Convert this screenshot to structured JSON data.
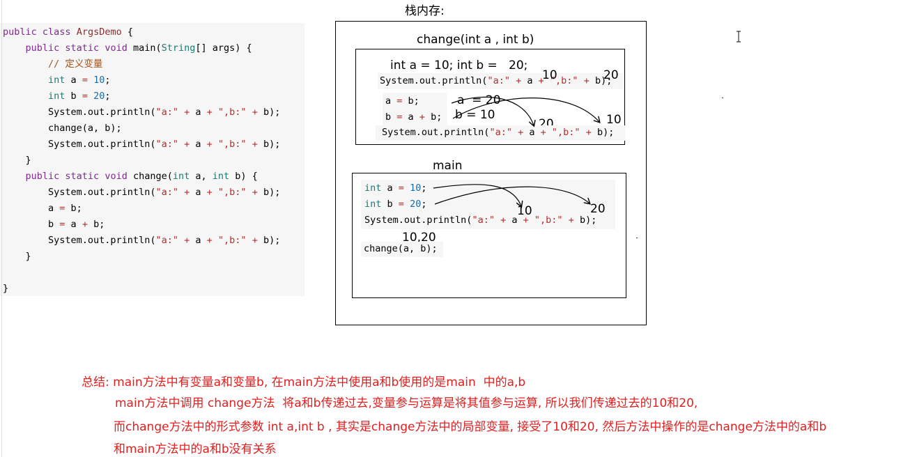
{
  "stack_title": "栈内存:",
  "code": {
    "lines": [
      [
        [
          "kw",
          "public "
        ],
        [
          "kw",
          "class "
        ],
        [
          "cls",
          "ArgsDemo"
        ],
        [
          "p",
          " {"
        ]
      ],
      [
        [
          "p",
          "    "
        ],
        [
          "kw",
          "public "
        ],
        [
          "kw",
          "static "
        ],
        [
          "kw",
          "void "
        ],
        [
          "p",
          "main("
        ],
        [
          "ty",
          "String"
        ],
        [
          "p",
          "[] args) {"
        ]
      ],
      [
        [
          "p",
          "        "
        ],
        [
          "cm",
          "// 定义变量"
        ]
      ],
      [
        [
          "p",
          "        "
        ],
        [
          "ty",
          "int"
        ],
        [
          "p",
          " a "
        ],
        [
          "op",
          "="
        ],
        [
          "p",
          " "
        ],
        [
          "num",
          "10"
        ],
        [
          "p",
          ";"
        ]
      ],
      [
        [
          "p",
          "        "
        ],
        [
          "ty",
          "int"
        ],
        [
          "p",
          " b "
        ],
        [
          "op",
          "="
        ],
        [
          "p",
          " "
        ],
        [
          "num",
          "20"
        ],
        [
          "p",
          ";"
        ]
      ],
      [
        [
          "p",
          "        System.out.println("
        ],
        [
          "str",
          "\"a:\""
        ],
        [
          "p",
          " "
        ],
        [
          "op",
          "+"
        ],
        [
          "p",
          " a "
        ],
        [
          "op",
          "+"
        ],
        [
          "p",
          " "
        ],
        [
          "str",
          "\",b:\""
        ],
        [
          "p",
          " "
        ],
        [
          "op",
          "+"
        ],
        [
          "p",
          " b);"
        ]
      ],
      [
        [
          "p",
          "        change(a, b);"
        ]
      ],
      [
        [
          "p",
          "        System.out.println("
        ],
        [
          "str",
          "\"a:\""
        ],
        [
          "p",
          " "
        ],
        [
          "op",
          "+"
        ],
        [
          "p",
          " a "
        ],
        [
          "op",
          "+"
        ],
        [
          "p",
          " "
        ],
        [
          "str",
          "\",b:\""
        ],
        [
          "p",
          " "
        ],
        [
          "op",
          "+"
        ],
        [
          "p",
          " b);"
        ]
      ],
      [
        [
          "p",
          "    }"
        ]
      ],
      [
        [
          "p",
          "    "
        ],
        [
          "kw",
          "public "
        ],
        [
          "kw",
          "static "
        ],
        [
          "kw",
          "void "
        ],
        [
          "p",
          "change("
        ],
        [
          "ty",
          "int"
        ],
        [
          "p",
          " a, "
        ],
        [
          "ty",
          "int"
        ],
        [
          "p",
          " b) {"
        ]
      ],
      [
        [
          "p",
          "        System.out.println("
        ],
        [
          "str",
          "\"a:\""
        ],
        [
          "p",
          " "
        ],
        [
          "op",
          "+"
        ],
        [
          "p",
          " a "
        ],
        [
          "op",
          "+"
        ],
        [
          "p",
          " "
        ],
        [
          "str",
          "\",b:\""
        ],
        [
          "p",
          " "
        ],
        [
          "op",
          "+"
        ],
        [
          "p",
          " b);"
        ]
      ],
      [
        [
          "p",
          "        a "
        ],
        [
          "op",
          "="
        ],
        [
          "p",
          " b;"
        ]
      ],
      [
        [
          "p",
          "        b "
        ],
        [
          "op",
          "="
        ],
        [
          "p",
          " a "
        ],
        [
          "op",
          "+"
        ],
        [
          "p",
          " b;"
        ]
      ],
      [
        [
          "p",
          "        System.out.println("
        ],
        [
          "str",
          "\"a:\""
        ],
        [
          "p",
          " "
        ],
        [
          "op",
          "+"
        ],
        [
          "p",
          " a "
        ],
        [
          "op",
          "+"
        ],
        [
          "p",
          " "
        ],
        [
          "str",
          "\",b:\""
        ],
        [
          "p",
          " "
        ],
        [
          "op",
          "+"
        ],
        [
          "p",
          " b);"
        ]
      ],
      [
        [
          "p",
          "    }"
        ]
      ],
      [
        [
          "p",
          ""
        ]
      ],
      [
        [
          "p",
          "}"
        ]
      ]
    ]
  },
  "change_frame": {
    "title": "change(int a , int b)",
    "params_line": "int a = 10; int b =   20;",
    "println1": [
      [
        "p",
        "System.out.println("
      ],
      [
        "str",
        "\"a:\""
      ],
      [
        "p",
        " "
      ],
      [
        "op",
        "+"
      ],
      [
        "p",
        " a "
      ],
      [
        "op",
        "+"
      ],
      [
        "p",
        " "
      ],
      [
        "str",
        "\",b:\""
      ],
      [
        "p",
        " "
      ],
      [
        "op",
        "+"
      ],
      [
        "p",
        " b);"
      ]
    ],
    "assign_a": [
      [
        "p",
        "a "
      ],
      [
        "op",
        "="
      ],
      [
        "p",
        " b;"
      ]
    ],
    "assign_b": [
      [
        "p",
        "b "
      ],
      [
        "op",
        "="
      ],
      [
        "p",
        " a "
      ],
      [
        "op",
        "+"
      ],
      [
        "p",
        " b;"
      ]
    ],
    "println2": [
      [
        "p",
        "System.out.println("
      ],
      [
        "str",
        "\"a:\""
      ],
      [
        "p",
        " "
      ],
      [
        "op",
        "+"
      ],
      [
        "p",
        " a "
      ],
      [
        "op",
        "+"
      ],
      [
        "p",
        " "
      ],
      [
        "str",
        "\",b:\""
      ],
      [
        "p",
        " "
      ],
      [
        "op",
        "+"
      ],
      [
        "p",
        " b);"
      ]
    ],
    "note_a": "a  = 20",
    "note_b": "b = 10",
    "val_10_top": "10",
    "val_20_top": "20",
    "val_20_mid": "20",
    "val_10_mid": "10"
  },
  "main_frame": {
    "title": "main",
    "decl_a": [
      [
        "ty",
        "int"
      ],
      [
        "p",
        " a "
      ],
      [
        "op",
        "="
      ],
      [
        "p",
        " "
      ],
      [
        "num",
        "10"
      ],
      [
        "p",
        ";"
      ]
    ],
    "decl_b": [
      [
        "ty",
        "int"
      ],
      [
        "p",
        " b "
      ],
      [
        "op",
        "="
      ],
      [
        "p",
        " "
      ],
      [
        "num",
        "20"
      ],
      [
        "p",
        ";"
      ]
    ],
    "println": [
      [
        "p",
        "System.out.println("
      ],
      [
        "str",
        "\"a:\""
      ],
      [
        "p",
        " "
      ],
      [
        "op",
        "+"
      ],
      [
        "p",
        " a "
      ],
      [
        "op",
        "+"
      ],
      [
        "p",
        " "
      ],
      [
        "str",
        "\",b:\""
      ],
      [
        "p",
        " "
      ],
      [
        "op",
        "+"
      ],
      [
        "p",
        " b);"
      ]
    ],
    "output": "10,20",
    "call": "change(a, b);",
    "val_a": "10",
    "val_b": "20"
  },
  "summary": {
    "line1": "总结: main方法中有变量a和变量b, 在main方法中使用a和b使用的是main  中的a,b",
    "line2": "main方法中调用 change方法  将a和b传递过去,变量参与运算是将其值参与运算, 所以我们传递过去的10和20,",
    "line3": "而change方法中的形式参数 int a,int b , 其实是change方法中的局部变量, 接受了10和20, 然后方法中操作的是change方法中的a和b",
    "line4": "和main方法中的a和b没有关系"
  },
  "cursor_icon": "text-cursor-icon",
  "colors": {
    "summary": "#e02020",
    "keyword": "#7a2b8a",
    "type": "#1c7a73",
    "string": "#b03030",
    "number": "#1a6aaa"
  }
}
